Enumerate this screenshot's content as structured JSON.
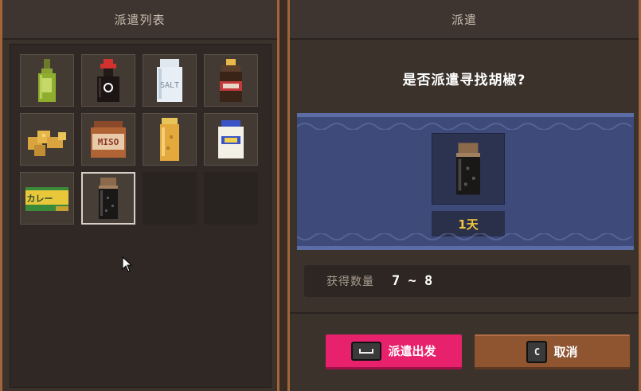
{
  "dispatch_list": {
    "title": "派遣列表",
    "items": [
      {
        "icon": "olive-oil-bottle-icon"
      },
      {
        "icon": "soy-sauce-bottle-icon"
      },
      {
        "icon": "salt-shaker-icon",
        "label": "SALT"
      },
      {
        "icon": "sauce-bottle-icon"
      },
      {
        "icon": "ginger-root-icon"
      },
      {
        "icon": "miso-jar-icon",
        "label": "MISO"
      },
      {
        "icon": "spice-jar-icon"
      },
      {
        "icon": "mayonnaise-jar-icon"
      },
      {
        "icon": "curry-roux-box-icon",
        "label": "カレー"
      },
      {
        "icon": "pepper-jar-icon",
        "selected": true
      },
      {
        "icon": "empty-slot"
      },
      {
        "icon": "empty-slot"
      }
    ]
  },
  "dispatch": {
    "title": "派遣",
    "question": "是否派遣寻找胡椒?",
    "item_icon": "pepper-jar-icon",
    "duration": "1天",
    "yield_label": "获得数量",
    "yield_value": "7 ~ 8",
    "confirm_label": "派遣出发",
    "confirm_key": "space-key-icon",
    "cancel_label": "取消",
    "cancel_key": "C"
  },
  "colors": {
    "accent_pink": "#e8216d",
    "cancel_brown": "#8e5530",
    "band_blue": "#3e4a7a",
    "gold_text": "#f4c63a",
    "frame_orange": "#a2653a"
  }
}
